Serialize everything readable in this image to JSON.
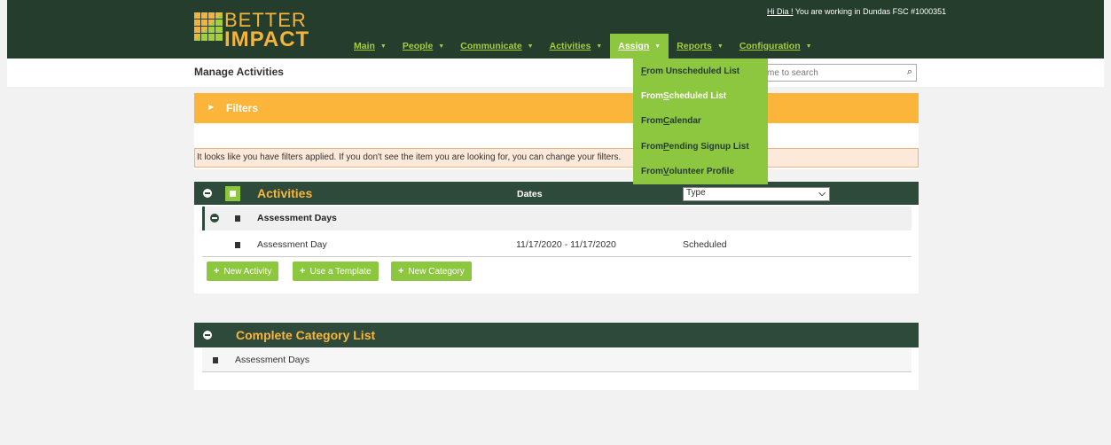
{
  "header": {
    "logo_line1": "BETTER",
    "logo_line2": "IMPACT",
    "greeting_hi": "Hi Dia !",
    "greeting_rest": " You are working in Dundas FSC #1000351"
  },
  "nav": [
    {
      "label": "Main"
    },
    {
      "label": "People"
    },
    {
      "label": "Communicate"
    },
    {
      "label": "Activities"
    },
    {
      "label": "Assign"
    },
    {
      "label": "Reports"
    },
    {
      "label": "Configuration"
    }
  ],
  "assign_menu": {
    "items": [
      {
        "prefix": "",
        "u": "F",
        "rest": "rom Unscheduled List"
      },
      {
        "prefix": "From ",
        "u": "S",
        "rest": "cheduled List"
      },
      {
        "prefix": "From ",
        "u": "C",
        "rest": "alendar"
      },
      {
        "prefix": "From ",
        "u": "P",
        "rest": "ending Signup List"
      },
      {
        "prefix": "From ",
        "u": "V",
        "rest": "olunteer Profile"
      }
    ]
  },
  "page": {
    "title": "Manage Activities",
    "search_placeholder": "me to search"
  },
  "filters": {
    "label": "Filters",
    "notice": "It looks like you have filters applied. If you don't see the item you are looking for, you can change your filters."
  },
  "activities": {
    "title": "Activities",
    "dates_header": "Dates",
    "type_select": "Type",
    "category": "Assessment Days",
    "rows": [
      {
        "name": "Assessment Day",
        "dates": "11/17/2020 - 11/17/2020",
        "type": "Scheduled"
      }
    ],
    "buttons": {
      "new_activity": "New Activity",
      "use_template": "Use a Template",
      "new_category": "New Category"
    }
  },
  "category_list": {
    "title": "Complete Category List",
    "items": [
      "Assessment Days"
    ]
  },
  "colors": {
    "header_bg": "#243d2d",
    "accent_orange": "#fab53a",
    "accent_green": "#8dc63f"
  }
}
